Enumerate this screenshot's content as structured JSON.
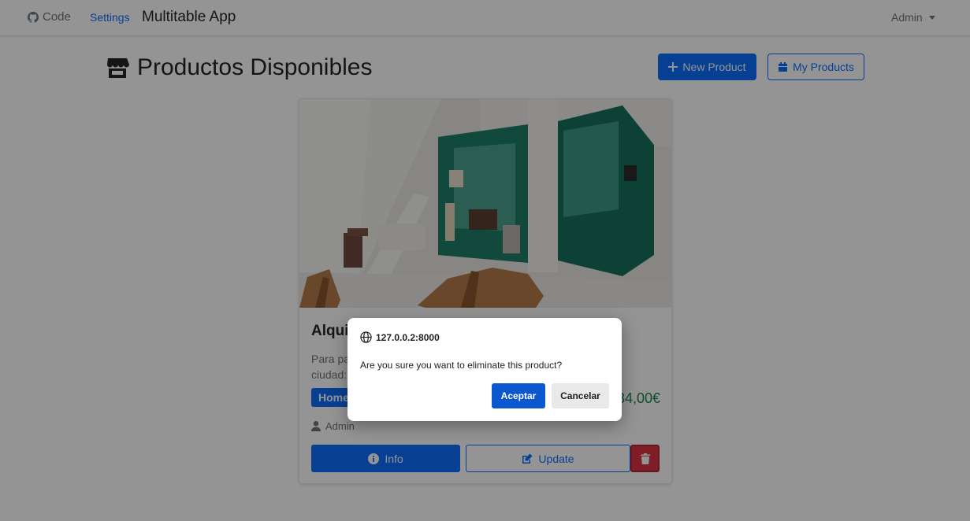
{
  "navbar": {
    "code_label": "Code",
    "settings_label": "Settings",
    "brand": "Multitable App",
    "user_menu": "Admin"
  },
  "header": {
    "title": "Productos Disponibles",
    "new_product_label": "New Product",
    "my_products_label": "My Products"
  },
  "product": {
    "title": "Alqui",
    "description_line1": "Para pa",
    "description_line2": "ciudad:",
    "category": "Home",
    "price": "34,00€",
    "owner": "Admin",
    "info_label": "Info",
    "update_label": "Update"
  },
  "dialog": {
    "origin": "127.0.0.2:8000",
    "message": "Are you sure you want to eliminate this product?",
    "accept_label": "Aceptar",
    "cancel_label": "Cancelar"
  },
  "colors": {
    "primary": "#0d6efd",
    "danger": "#dc3545",
    "success": "#198754",
    "dialog_accept": "#0b57d0"
  },
  "icons": {
    "code": "github-icon",
    "title": "store-icon",
    "new_product": "plus-icon",
    "my_products": "calendar-icon",
    "owner": "user-icon",
    "info": "info-circle-icon",
    "update": "edit-icon",
    "delete": "trash-icon",
    "dialog_origin": "globe-icon"
  }
}
